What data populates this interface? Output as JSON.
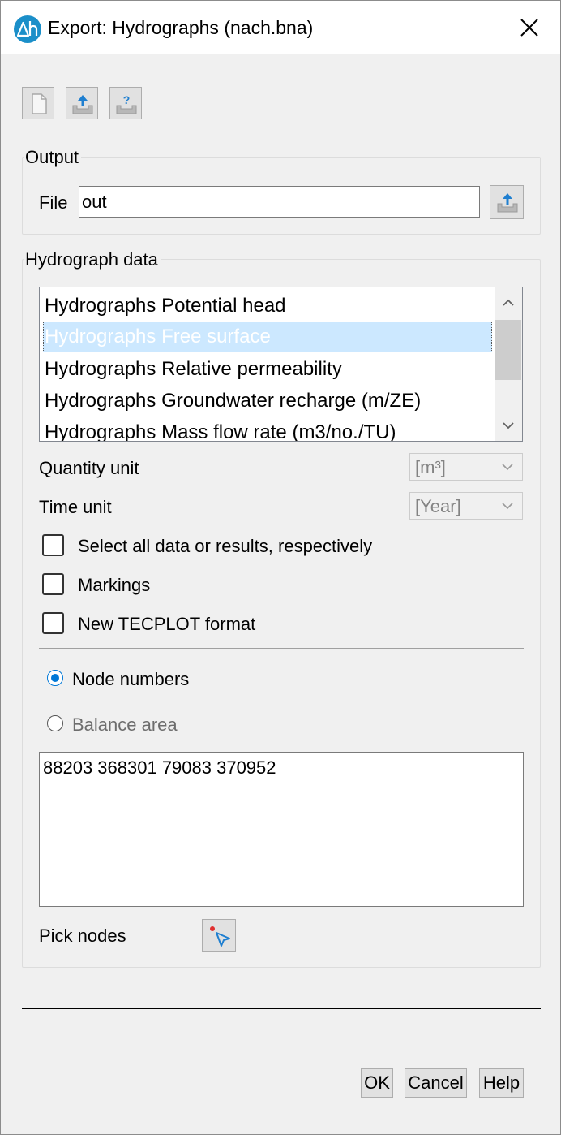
{
  "window": {
    "title": "Export: Hydrographs (nach.bna)"
  },
  "toolbar": {
    "icons": [
      "new-document-icon",
      "export-icon",
      "export-help-icon"
    ]
  },
  "output": {
    "group_label": "Output",
    "file_label": "File",
    "file_value": "out"
  },
  "hydrograph_data": {
    "group_label": "Hydrograph data",
    "items": [
      "Hydrographs Potential head",
      "Hydrographs Free surface",
      "Hydrographs Relative permeability",
      "Hydrographs Groundwater recharge (m/ZE)",
      "Hydrographs Mass flow rate (m3/no./TU)"
    ],
    "selected_index": 1,
    "quantity_unit_label": "Quantity unit",
    "quantity_unit_value": "[m³]",
    "time_unit_label": "Time unit",
    "time_unit_value": "[Year]",
    "checkboxes": [
      {
        "label": "Select all data or results, respectively",
        "checked": false
      },
      {
        "label": "Markings",
        "checked": false
      },
      {
        "label": "New TECPLOT format",
        "checked": false
      }
    ],
    "radio_node_numbers": "Node numbers",
    "radio_balance_area": "Balance area",
    "nodes_text": "88203 368301 79083 370952",
    "pick_nodes_label": "Pick nodes"
  },
  "buttons": {
    "ok": "OK",
    "cancel": "Cancel",
    "help": "Help"
  },
  "colors": {
    "accent": "#0078d7",
    "selection_bg": "#cce8ff",
    "app_icon": "#1b8fc9"
  }
}
